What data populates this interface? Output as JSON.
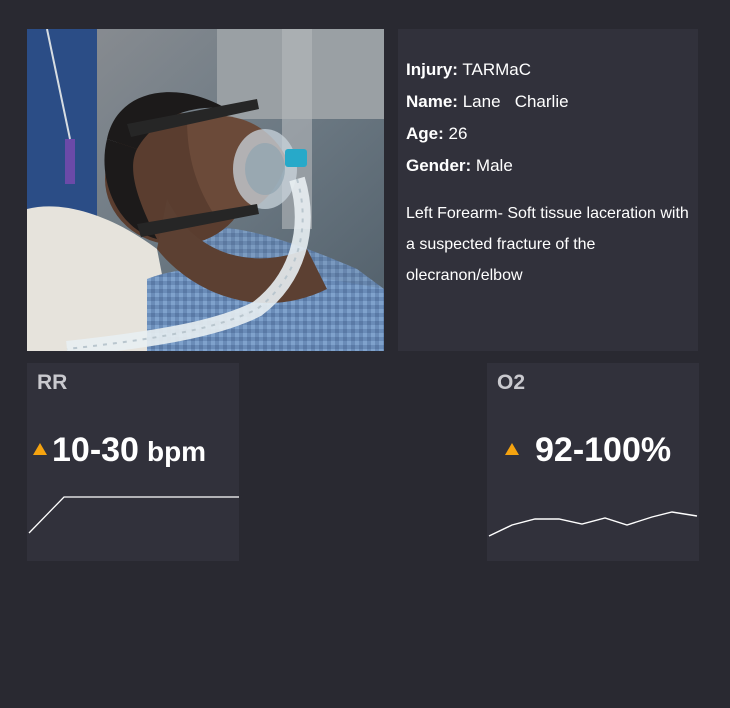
{
  "patient": {
    "injury_label": "Injury:",
    "injury_value": "TARMaC",
    "name_label": "Name:",
    "name_value": "Lane   Charlie",
    "age_label": "Age:",
    "age_value": "26",
    "gender_label": "Gender:",
    "gender_value": "Male",
    "description": "Left Forearm- Soft tissue laceration with a suspected fracture of the olecranon/elbow"
  },
  "vitals": {
    "rr": {
      "title": "RR",
      "value": "10-30",
      "unit": "bpm",
      "trend_icon": "triangle-up-icon",
      "trend_color": "#f5a30f"
    },
    "o2": {
      "title": "O2",
      "value": "92-100%",
      "trend_icon": "triangle-up-icon",
      "trend_color": "#f5a30f"
    }
  },
  "colors": {
    "background": "#292931",
    "card": "#31313b",
    "accent": "#f5a30f"
  }
}
